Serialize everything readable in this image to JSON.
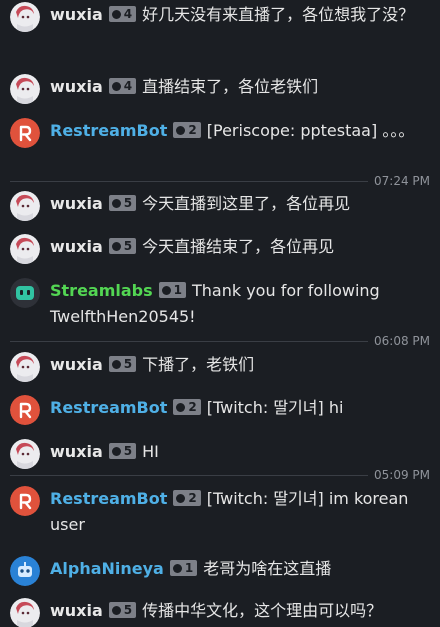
{
  "colors": {
    "background": "#1b1e23",
    "text": "#e6e6e6",
    "badge": "#7d8088",
    "separator": "#3a3e45",
    "timestamp": "#8f939a"
  },
  "users": {
    "wuxia": {
      "name": "wuxia",
      "color": "#e8e8e8",
      "avatar": "anime-girl-icon"
    },
    "restream": {
      "name": "RestreamBot",
      "color": "#4fb0e6",
      "avatar": "restream-logo-icon"
    },
    "streamlabs": {
      "name": "Streamlabs",
      "color": "#53d653",
      "avatar": "streamlabs-logo-icon"
    },
    "alpha": {
      "name": "AlphaNineya",
      "color": "#4fb0e6",
      "avatar": "robot-icon"
    }
  },
  "messages": [
    {
      "user": "wuxia",
      "level": "4",
      "text": "好几天没有来直播了，各位想我了没？"
    },
    {
      "user": "wuxia",
      "level": "4",
      "text": "直播结束了，各位老铁们"
    },
    {
      "user": "RestreamBot",
      "level": "2",
      "text": "[Periscope: pptestaa] 。。。"
    },
    {
      "user": "wuxia",
      "level": "5",
      "text": "今天直播到这里了，各位再见"
    },
    {
      "user": "wuxia",
      "level": "5",
      "text": "今天直播结束了，各位再见"
    },
    {
      "user": "Streamlabs",
      "level": "1",
      "text": "Thank you for following TwelfthHen20545!"
    },
    {
      "user": "wuxia",
      "level": "5",
      "text": "下播了，老铁们"
    },
    {
      "user": "RestreamBot",
      "level": "2",
      "text": "[Twitch: 딸기녀] hi"
    },
    {
      "user": "wuxia",
      "level": "5",
      "text": "HI"
    },
    {
      "user": "RestreamBot",
      "level": "2",
      "text": "[Twitch: 딸기녀] im korean user"
    },
    {
      "user": "AlphaNineya",
      "level": "1",
      "text": "老哥为啥在这直播"
    },
    {
      "user": "wuxia",
      "level": "5",
      "text": "传播中华文化，这个理由可以吗？"
    }
  ],
  "timestamps": [
    "07:24 PM",
    "06:08 PM",
    "05:09 PM"
  ]
}
